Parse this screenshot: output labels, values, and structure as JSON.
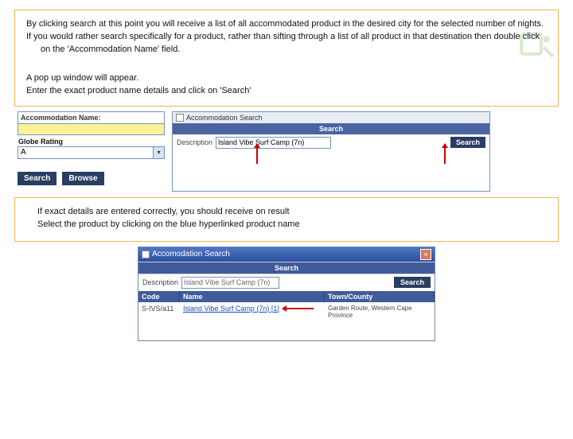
{
  "logo": {
    "color": "#6aaf44"
  },
  "box1": {
    "p1": "By clicking search at this point you will receive a list of all accommodated product in the desired city for the selected number of nights.",
    "p2": "If you would rather search specifically for a product, rather than sifting through a list of all product in that destination then double click on the 'Accommodation Name' field.",
    "p3": "A pop up window will appear.",
    "p4": "Enter the exact product name details and click on 'Search'"
  },
  "leftPanel": {
    "accName": "Accommodation Name:",
    "rating": "Globe Rating",
    "ratingValue": "A",
    "searchBtn": "Search",
    "browseBtn": "Browse"
  },
  "rightPanel": {
    "title": "Accommodation Search",
    "searchBar": "Search",
    "descLabel": "Description",
    "descValue": "Island Vibe Surf Camp (7n)",
    "searchBtn": "Search"
  },
  "box2": {
    "p1": "If exact details are entered correctly, you should receive on result",
    "p2": "Select the product by clicking on the blue hyperlinked product name"
  },
  "win": {
    "title": "Accomodation Search",
    "searchBar": "Search",
    "descLabel": "Description",
    "descValue": "Island Vibe Surf Camp (7n)",
    "searchBtn": "Search",
    "col1": "Code",
    "col2": "Name",
    "col3": "Town/County",
    "rowCode": "S-IVS/a11",
    "rowName": "Island Vibe Surf Camp (7n) [1]",
    "rowTown": "Garden Route, Western Cape Province"
  }
}
